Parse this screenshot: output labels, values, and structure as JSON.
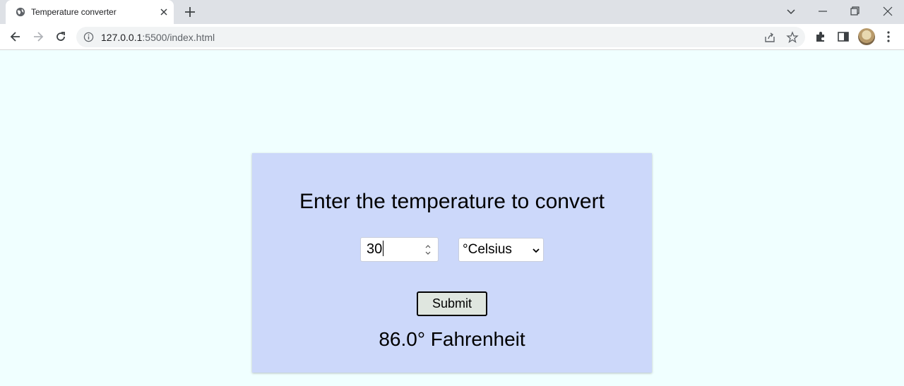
{
  "browser": {
    "tab": {
      "title": "Temperature converter",
      "favicon": "globe-icon"
    },
    "address": {
      "host": "127.0.0.1",
      "path": ":5500/index.html"
    }
  },
  "page": {
    "heading": "Enter the temperature to convert",
    "input": {
      "value": "30"
    },
    "unit_select": {
      "selected": "°Celsius"
    },
    "submit_label": "Submit",
    "result": "86.0° Fahrenheit"
  },
  "colors": {
    "page_background": "#f0ffff",
    "card_background": "#ccd8fa",
    "button_background": "#dfe6df"
  }
}
